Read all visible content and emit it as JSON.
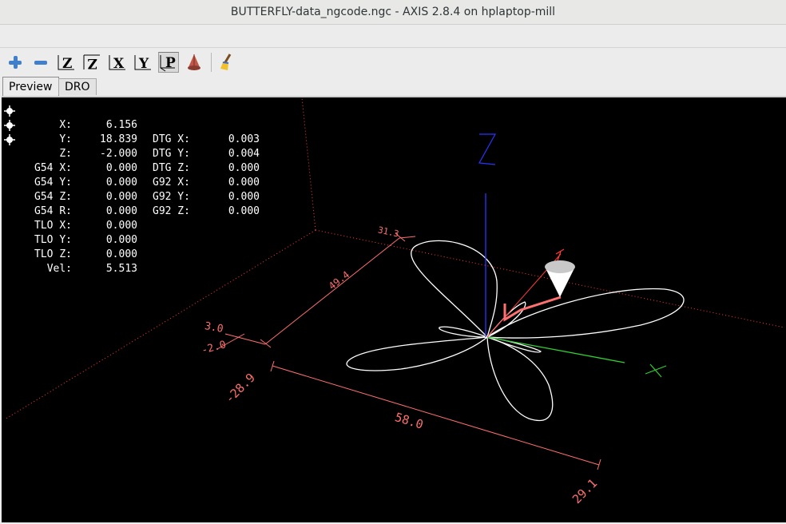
{
  "window": {
    "title": "BUTTERFLY-data_ngcode.ngc - AXIS 2.8.4 on hplaptop-mill"
  },
  "toolbar": {
    "buttons": [
      {
        "name": "zoom-in-button",
        "icon": "plus-icon"
      },
      {
        "name": "zoom-out-button",
        "icon": "minus-icon"
      },
      {
        "name": "view-z-button",
        "icon": "view-z-icon",
        "label": "Z"
      },
      {
        "name": "view-z2-button",
        "icon": "view-z-rotated-icon",
        "label": "Z"
      },
      {
        "name": "view-x-button",
        "icon": "view-x-icon",
        "label": "X"
      },
      {
        "name": "view-y-button",
        "icon": "view-y-icon",
        "label": "Y"
      },
      {
        "name": "view-p-button",
        "icon": "view-p-icon",
        "label": "P",
        "active": true
      },
      {
        "name": "toggle-tool-button",
        "icon": "tool-cone-icon"
      },
      {
        "name": "clear-plot-button",
        "icon": "broom-icon"
      }
    ]
  },
  "tabs": [
    {
      "label": "Preview",
      "selected": true
    },
    {
      "label": "DRO",
      "selected": false
    }
  ],
  "dro": {
    "left": [
      {
        "label": "X:",
        "value": "6.156"
      },
      {
        "label": "Y:",
        "value": "18.839"
      },
      {
        "label": "Z:",
        "value": "-2.000"
      },
      {
        "label": "G54 X:",
        "value": "0.000"
      },
      {
        "label": "G54 Y:",
        "value": "0.000"
      },
      {
        "label": "G54 Z:",
        "value": "0.000"
      },
      {
        "label": "G54 R:",
        "value": "0.000"
      },
      {
        "label": "TLO X:",
        "value": "0.000"
      },
      {
        "label": "TLO Y:",
        "value": "0.000"
      },
      {
        "label": "TLO Z:",
        "value": "0.000"
      },
      {
        "label": "Vel:",
        "value": "5.513"
      }
    ],
    "right": [
      {
        "label": "DTG X:",
        "value": "0.003"
      },
      {
        "label": "DTG Y:",
        "value": "0.004"
      },
      {
        "label": "DTG Z:",
        "value": "0.000"
      },
      {
        "label": "G92 X:",
        "value": "0.000"
      },
      {
        "label": "G92 Y:",
        "value": "0.000"
      },
      {
        "label": "G92 Z:",
        "value": "0.000"
      }
    ]
  },
  "preview": {
    "axis_labels": {
      "x": "X",
      "y": "Y",
      "z": "Z"
    },
    "dimensions": {
      "y_min": "-28.9",
      "width": "58.0",
      "x_max": "29.1",
      "height": "49.4",
      "y_max": "31.3",
      "z_top": "3.0",
      "z_bottom": "-2.0"
    },
    "colors": {
      "background": "#000000",
      "dimension": "#ff6f6f",
      "limits": "#ff3b3b",
      "toolpath": "#ffffff",
      "x_axis": "#2fd02f",
      "z_axis": "#2a35ff",
      "tool_trail": "#ff5050"
    }
  }
}
